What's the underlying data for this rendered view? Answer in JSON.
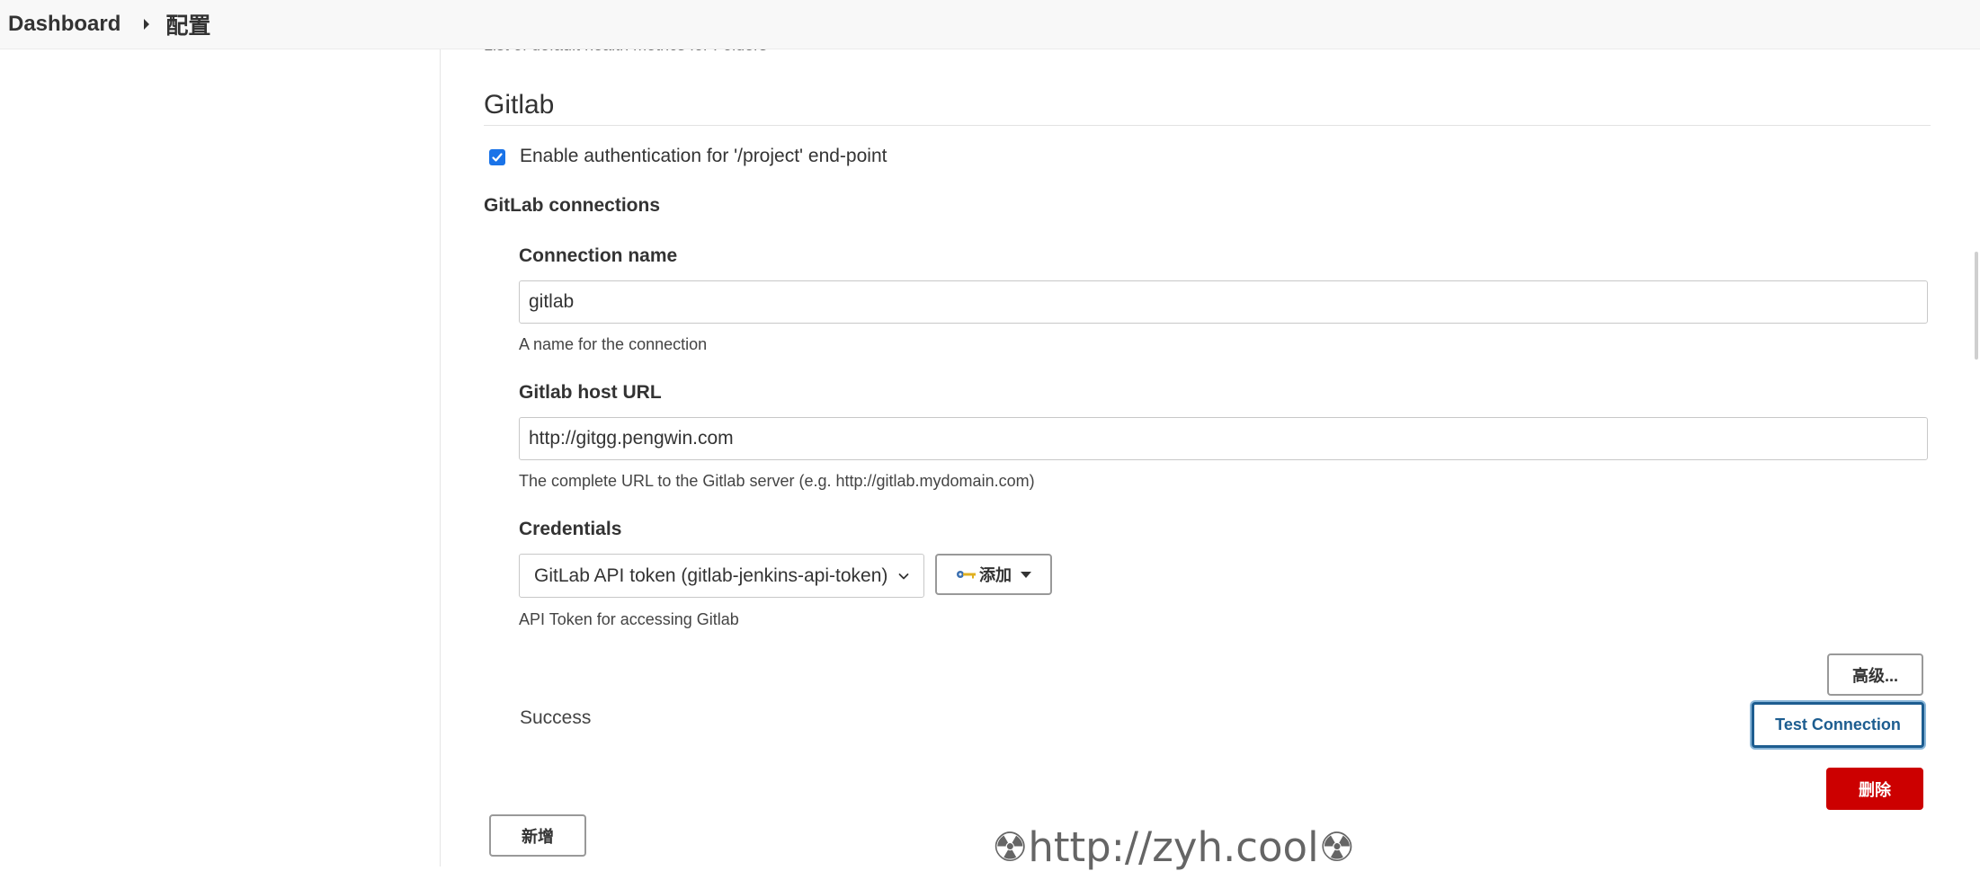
{
  "breadcrumb": {
    "home": "Dashboard",
    "current": "配置"
  },
  "clipped_help": "List of default health metrics for Folders",
  "section": {
    "title": "Gitlab",
    "auth_checkbox": {
      "label": "Enable authentication for '/project' end-point",
      "checked": true
    },
    "connections_heading": "GitLab connections"
  },
  "connection": {
    "name_label": "Connection name",
    "name_value": "gitlab",
    "name_help": "A name for the connection",
    "url_label": "Gitlab host URL",
    "url_value": "http://gitgg.pengwin.com",
    "url_help": "The complete URL to the Gitlab server (e.g. http://gitlab.mydomain.com)",
    "credentials_label": "Credentials",
    "credentials_selected": "GitLab API token (gitlab-jenkins-api-token)",
    "credentials_help": "API Token for accessing Gitlab",
    "add_button": "添加",
    "advanced_button": "高级...",
    "status": "Success",
    "test_button": "Test Connection",
    "delete_button": "删除"
  },
  "new_button": "新增",
  "watermark": "☢http://zyh.cool☢",
  "colors": {
    "accent": "#1d5d90",
    "danger": "#cc0000",
    "checkbox": "#1a73e8"
  }
}
